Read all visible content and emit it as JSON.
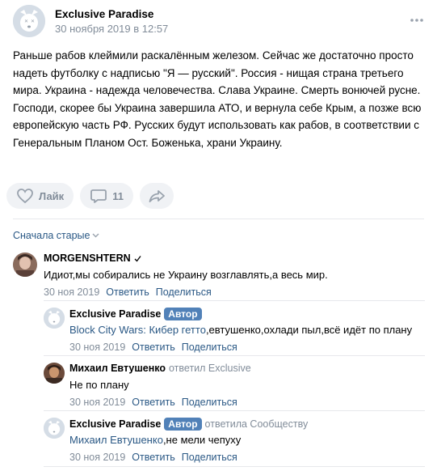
{
  "post": {
    "author": "Exclusive Paradise",
    "date": "30 ноября 2019 в 12:57",
    "text": "Раньше рабов клеймили раскалённым железом. Сейчас же достаточно просто надеть футболку с надписью \"Я — русский\". Россия - нищая страна третьего мира. Украина - надежда человечества. Слава Украине. Смерть вонючей русне. Господи, скорее бы Украина завершила АТО, и вернула себе Крым, а позже всю европейскую часть РФ. Русских будут использовать как рабов, в соответствии с Генеральным Планом Ост. Боженька, храни Украину."
  },
  "actions": {
    "like_label": "Лайк",
    "comments_count": "11"
  },
  "comments_sort": "Сначала старые",
  "comments": [
    {
      "author": "MORGENSHTERN",
      "verified": true,
      "text": "Идиот,мы собирались не Украину возглавлять,а весь мир.",
      "date": "30 ноя 2019",
      "reply_label": "Ответить",
      "share_label": "Поделиться"
    },
    {
      "author": "Exclusive Paradise",
      "badge": "Автор",
      "mention": "Block City Wars: Кибер гетто",
      "text": ",евтушенко,охлади пыл,всё идёт по плану",
      "date": "30 ноя 2019",
      "reply_label": "Ответить",
      "share_label": "Поделиться"
    },
    {
      "author": "Михаил Евтушенко",
      "replied_to": "ответил Exclusive",
      "text": "Не по плану",
      "date": "30 ноя 2019",
      "reply_label": "Ответить",
      "share_label": "Поделиться"
    },
    {
      "author": "Exclusive Paradise",
      "badge": "Автор",
      "replied_to": "ответила Сообществу",
      "mention": "Михаил Евтушенко",
      "text": ",не мели чепуху",
      "date": "30 ноя 2019",
      "reply_label": "Ответить",
      "share_label": "Поделиться"
    }
  ],
  "colors": {
    "link": "#2a5885",
    "secondary": "#818c99",
    "badge": "#5181b8",
    "button_bg": "#f0f2f5"
  }
}
